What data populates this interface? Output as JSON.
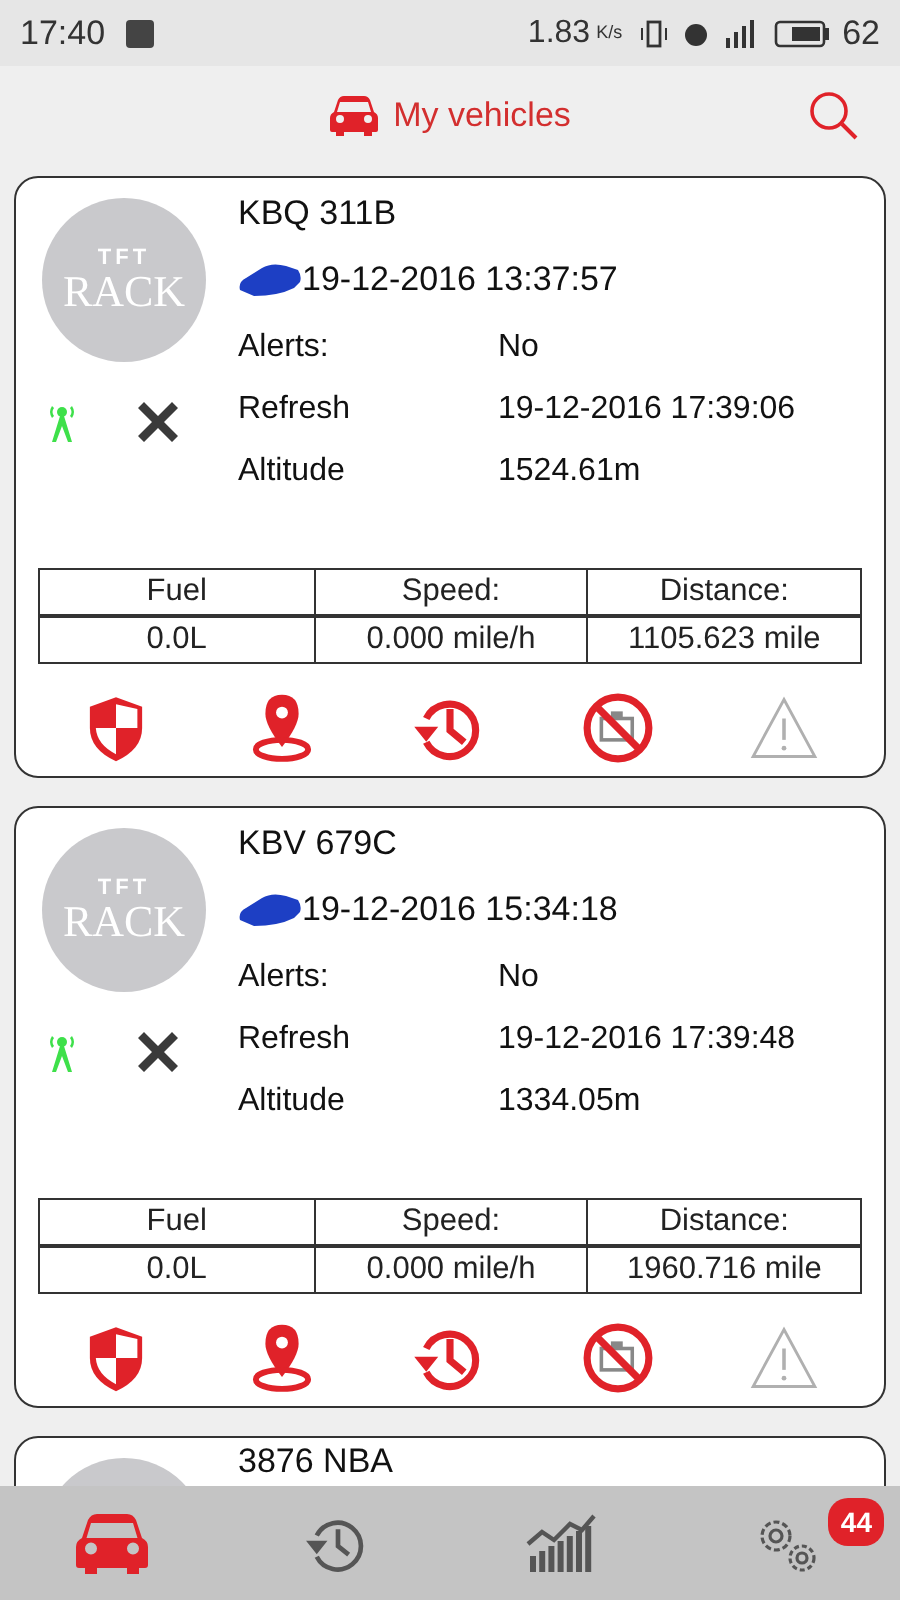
{
  "status_bar": {
    "time": "17:40",
    "speed": "1.83",
    "speed_unit": "K/s",
    "battery": "62"
  },
  "header": {
    "title": "My vehicles"
  },
  "vehicles": [
    {
      "logo_top": "TFT",
      "logo_bottom": "RACK",
      "plate": "KBQ 311B",
      "last_seen": "19-12-2016 13:37:57",
      "gps_on": true,
      "fields": [
        {
          "label": "Alerts:",
          "value": "No"
        },
        {
          "label": "Refresh",
          "value": "19-12-2016 17:39:06"
        },
        {
          "label": "Altitude",
          "value": "1524.61m"
        }
      ],
      "table": {
        "columns": [
          "Fuel",
          "Speed:",
          "Distance:"
        ],
        "values": [
          "0.0L",
          "0.000 mile/h",
          "1105.623 mile"
        ]
      },
      "actions": [
        {
          "kind": "shield",
          "active": true
        },
        {
          "kind": "location",
          "active": true
        },
        {
          "kind": "history",
          "active": true
        },
        {
          "kind": "engine",
          "active": true
        },
        {
          "kind": "warning",
          "active": false
        }
      ]
    },
    {
      "logo_top": "TFT",
      "logo_bottom": "RACK",
      "plate": "KBV 679C",
      "last_seen": "19-12-2016 15:34:18",
      "gps_on": true,
      "fields": [
        {
          "label": "Alerts:",
          "value": "No"
        },
        {
          "label": "Refresh",
          "value": "19-12-2016 17:39:48"
        },
        {
          "label": "Altitude",
          "value": "1334.05m"
        }
      ],
      "table": {
        "columns": [
          "Fuel",
          "Speed:",
          "Distance:"
        ],
        "values": [
          "0.0L",
          "0.000 mile/h",
          "1960.716 mile"
        ]
      },
      "actions": [
        {
          "kind": "shield",
          "active": true
        },
        {
          "kind": "location",
          "active": true
        },
        {
          "kind": "history",
          "active": true
        },
        {
          "kind": "engine",
          "active": true
        },
        {
          "kind": "warning",
          "active": false
        }
      ]
    },
    {
      "plate": "3876 NBA"
    }
  ],
  "bottom_nav": [
    {
      "kind": "vehicles",
      "selected": true
    },
    {
      "kind": "history",
      "selected": false
    },
    {
      "kind": "reports",
      "selected": false
    },
    {
      "kind": "settings",
      "selected": false,
      "badge": "44"
    }
  ]
}
